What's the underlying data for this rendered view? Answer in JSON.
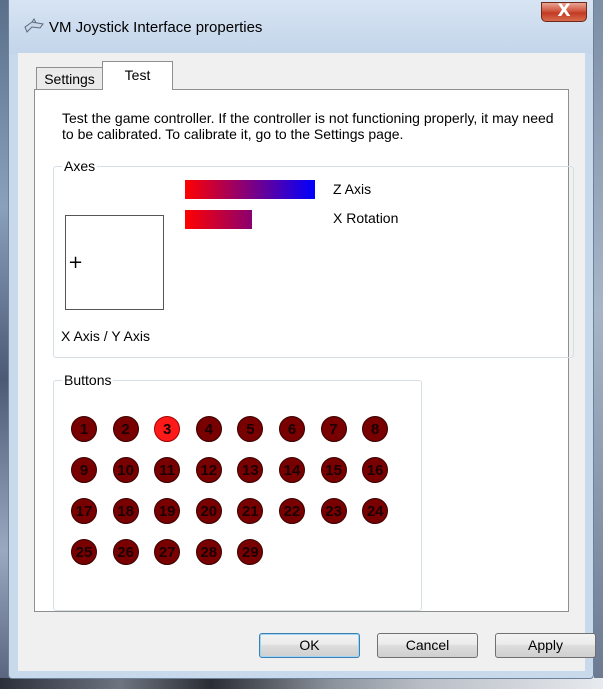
{
  "window": {
    "title": "VM Joystick Interface properties",
    "close_symbol": "X"
  },
  "tabs": [
    {
      "label": "Settings",
      "active": false
    },
    {
      "label": "Test",
      "active": true
    }
  ],
  "test_page": {
    "description": "Test the game controller.  If the controller is not functioning properly, it may need to be calibrated.  To calibrate it, go to the Settings page.",
    "axes": {
      "group_label": "Axes",
      "xy_label": "X Axis / Y Axis",
      "crosshair": "+",
      "bars": [
        {
          "label": "Z Axis",
          "level": 1.0
        },
        {
          "label": "X Rotation",
          "level": 0.52
        }
      ]
    },
    "buttons": {
      "group_label": "Buttons",
      "items": [
        "1",
        "2",
        "3",
        "4",
        "5",
        "6",
        "7",
        "8",
        "9",
        "10",
        "11",
        "12",
        "13",
        "14",
        "15",
        "16",
        "17",
        "18",
        "19",
        "20",
        "21",
        "22",
        "23",
        "24",
        "25",
        "26",
        "27",
        "28",
        "29"
      ],
      "pressed": [
        "3"
      ],
      "colors": {
        "off": "#780000",
        "on": "#ff1a1a"
      }
    }
  },
  "footer": {
    "ok_label": "OK",
    "cancel_label": "Cancel",
    "apply_label": "Apply"
  }
}
